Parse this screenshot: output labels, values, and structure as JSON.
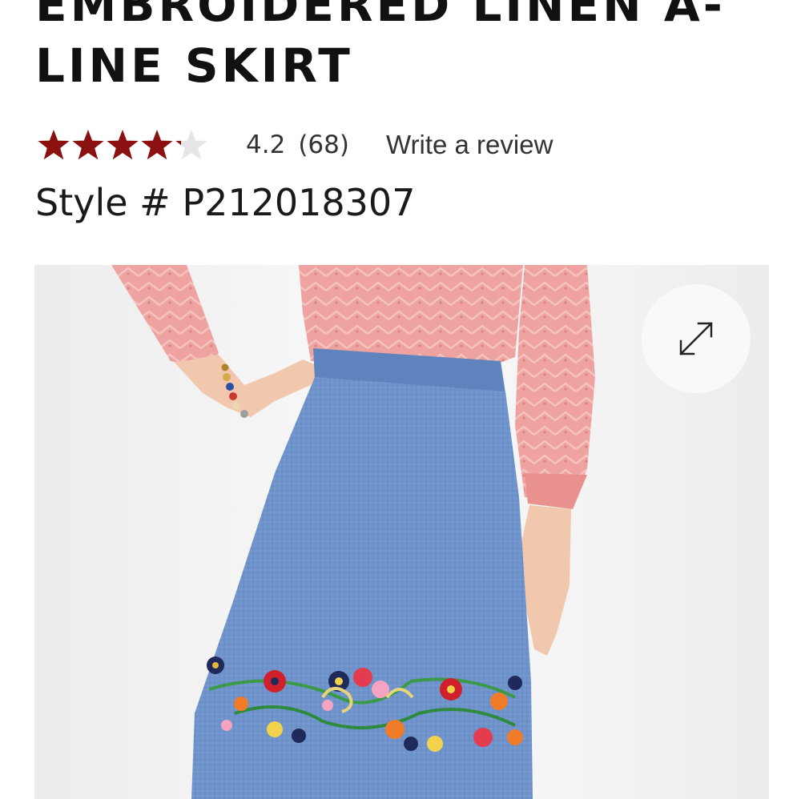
{
  "product": {
    "title": "EMBROIDERED LINEN A-LINE SKIRT",
    "rating": {
      "value": 4.2,
      "value_text": "4.2",
      "count_text": "(68)",
      "max_stars": 5,
      "star_color": "#8b1010",
      "empty_star_color": "#e6e6e6"
    },
    "write_review_label": "Write a review",
    "style_label": "Style # P212018307"
  },
  "image": {
    "icon": "expand-icon",
    "skirt_color": "#6f93cb",
    "sweater_color": "#eea3a0"
  }
}
